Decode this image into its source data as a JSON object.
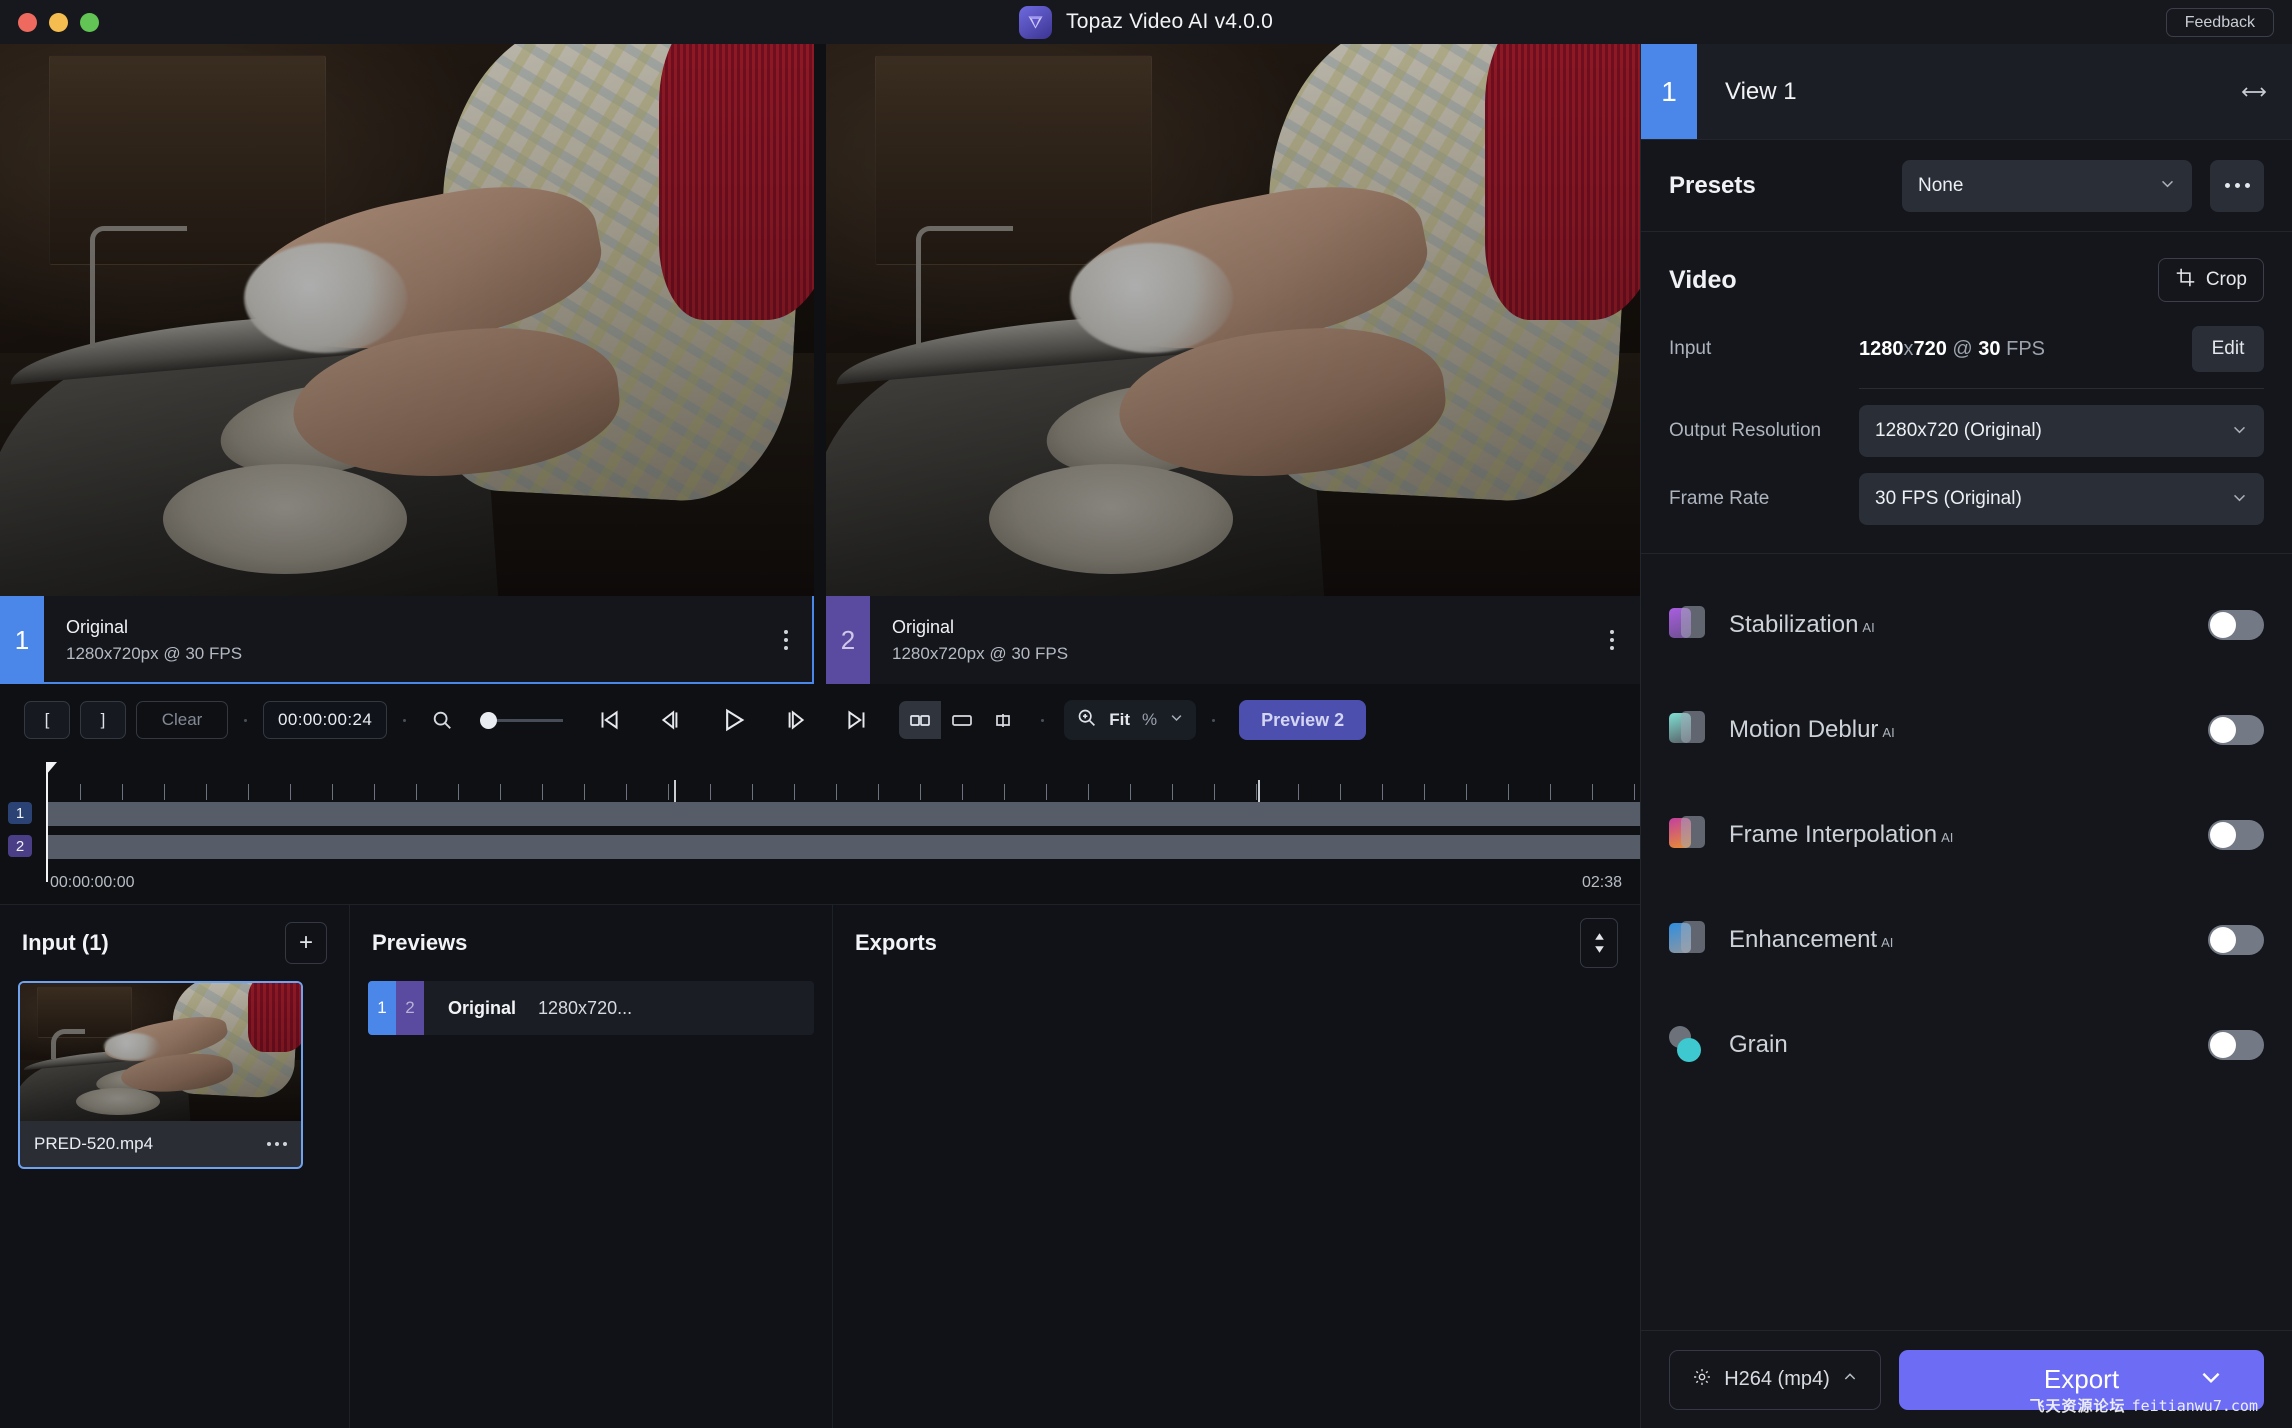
{
  "titlebar": {
    "app_title": "Topaz Video AI  v4.0.0",
    "feedback_label": "Feedback",
    "logo_icon": "topaz-logo-icon",
    "traffic_lights": [
      "close-red",
      "minimize-yellow",
      "maximize-green"
    ]
  },
  "viewer": {
    "panes": [
      {
        "badge": "1",
        "name": "Original",
        "meta": "1280x720px @ 30 FPS",
        "selected": true
      },
      {
        "badge": "2",
        "name": "Original",
        "meta": "1280x720px @ 30 FPS",
        "selected": false
      }
    ]
  },
  "transport": {
    "in_point_label": "[",
    "out_point_label": "]",
    "clear_label": "Clear",
    "timecode": "00:00:00:24",
    "search_icon": "magnifier-icon",
    "go_start_icon": "skip-to-start-icon",
    "prev_frame_icon": "step-back-icon",
    "play_icon": "play-icon",
    "next_frame_icon": "step-forward-icon",
    "go_end_icon": "skip-to-end-icon",
    "view_split_icon": "split-view-icon",
    "view_single_icon": "single-view-icon",
    "view_compare_icon": "side-by-side-compare-icon",
    "zoom_icon": "zoom-in-icon",
    "zoom_value": "Fit",
    "zoom_unit": "%",
    "preview_label": "Preview 2"
  },
  "timeline": {
    "track_numbers": [
      "1",
      "2"
    ],
    "start_time": "00:00:00:00",
    "end_time": "02:38"
  },
  "panels": {
    "input": {
      "title": "Input (1)",
      "add_label": "+",
      "items": [
        {
          "filename": "PRED-520.mp4",
          "selected": true,
          "menu_icon": "more-options-icon"
        }
      ]
    },
    "previews": {
      "title": "Previews",
      "rows": [
        {
          "num1": "1",
          "num2": "2",
          "name": "Original",
          "resolution": "1280x720..."
        }
      ]
    },
    "exports": {
      "title": "Exports",
      "sort_icon": "sort-updown-icon",
      "rows": []
    }
  },
  "right_panel": {
    "view": {
      "badge": "1",
      "title": "View 1",
      "resize_icon": "horizontal-resize-icon"
    },
    "presets": {
      "label": "Presets",
      "selected": "None",
      "chevron_icon": "chevron-down-icon",
      "more_icon": "more-options-icon"
    },
    "video": {
      "title": "Video",
      "crop_label": "Crop",
      "crop_icon": "crop-icon",
      "input_label": "Input",
      "input_width": "1280",
      "input_x": "x",
      "input_height": "720",
      "input_at": " @ ",
      "input_fps_num": "30",
      "input_fps_unit": " FPS",
      "edit_label": "Edit",
      "output_resolution_label": "Output Resolution",
      "output_resolution_value": "1280x720 (Original)",
      "frame_rate_label": "Frame Rate",
      "frame_rate_value": "30 FPS (Original)"
    },
    "filters": [
      {
        "name": "Stabilization",
        "ai": "AI",
        "enabled": false,
        "icon": "stabilization-icon",
        "c1": "#a95fe0",
        "c2": "#6d4f8f"
      },
      {
        "name": "Motion Deblur",
        "ai": "AI",
        "enabled": false,
        "icon": "motion-deblur-icon",
        "c1": "#7fe0d4",
        "c2": "#585e66"
      },
      {
        "name": "Frame Interpolation",
        "ai": "AI",
        "enabled": false,
        "icon": "frame-interpolation-icon",
        "c1": "#c23fa0",
        "c2": "#e8902f"
      },
      {
        "name": "Enhancement",
        "ai": "AI",
        "enabled": false,
        "icon": "enhancement-icon",
        "c1": "#2f8fe0",
        "c2": "#8f969f"
      },
      {
        "name": "Grain",
        "ai": "",
        "enabled": false,
        "icon": "grain-icon",
        "c1": "#6d727a",
        "c2": "#3ec8cf"
      }
    ],
    "export_bar": {
      "codec_label": "H264 (mp4)",
      "codec_icon": "gear-icon",
      "codec_chevron": "chevron-up-icon",
      "export_label": "Export",
      "export_chevron": "chevron-down-icon"
    }
  },
  "watermark": {
    "cn": "飞天资源论坛",
    "en": "feitianwu7.com"
  },
  "colors": {
    "accent_blue": "#4b87e8",
    "accent_purple": "#5b4ba0",
    "export_purple": "#6c6cf5",
    "preview_purple": "#4d4fae",
    "panel_bg": "#14161b",
    "app_bg": "#0e1014"
  }
}
